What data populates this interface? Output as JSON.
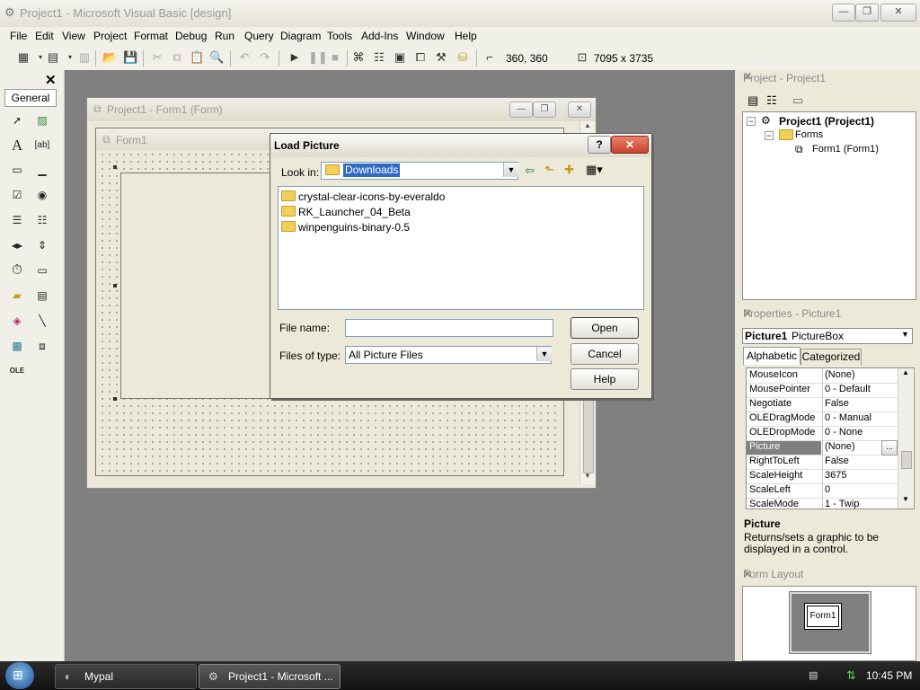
{
  "window": {
    "title": "Project1 - Microsoft Visual Basic [design]"
  },
  "menu": [
    "File",
    "Edit",
    "View",
    "Project",
    "Format",
    "Debug",
    "Run",
    "Query",
    "Diagram",
    "Tools",
    "Add-Ins",
    "Window",
    "Help"
  ],
  "toolbar": {
    "position": "360, 360",
    "size": "7095 x 3735"
  },
  "toolbox": {
    "tab_label": "General"
  },
  "form_window": {
    "title": "Project1 - Form1 (Form)",
    "form_caption": "Form1"
  },
  "dialog": {
    "title": "Load Picture",
    "look_in_label": "Look in:",
    "look_in_value": "Downloads",
    "files": [
      "crystal-clear-icons-by-everaldo",
      "RK_Launcher_04_Beta",
      "winpenguins-binary-0.5"
    ],
    "file_name_label": "File name:",
    "file_name_value": "",
    "files_of_type_label": "Files of type:",
    "files_of_type_value": "All Picture Files",
    "open_label": "Open",
    "cancel_label": "Cancel",
    "help_label": "Help",
    "help_icon": "?",
    "close_icon": "✕"
  },
  "project_panel": {
    "title": "Project - Project1",
    "root": "Project1 (Project1)",
    "folder": "Forms",
    "item": "Form1 (Form1)"
  },
  "properties_panel": {
    "title": "Properties - Picture1",
    "object_name": "Picture1",
    "object_type": "PictureBox",
    "tab_alpha": "Alphabetic",
    "tab_cat": "Categorized",
    "rows": [
      {
        "name": "MouseIcon",
        "value": "(None)"
      },
      {
        "name": "MousePointer",
        "value": "0 - Default"
      },
      {
        "name": "Negotiate",
        "value": "False"
      },
      {
        "name": "OLEDragMode",
        "value": "0 - Manual"
      },
      {
        "name": "OLEDropMode",
        "value": "0 - None"
      },
      {
        "name": "Picture",
        "value": "(None)"
      },
      {
        "name": "RightToLeft",
        "value": "False"
      },
      {
        "name": "ScaleHeight",
        "value": "3675"
      },
      {
        "name": "ScaleLeft",
        "value": "0"
      },
      {
        "name": "ScaleMode",
        "value": "1 - Twip"
      }
    ],
    "desc_title": "Picture",
    "desc_text": "Returns/sets a graphic to be displayed in a control."
  },
  "layout_panel": {
    "title": "Form Layout",
    "form_label": "Form1"
  },
  "taskbar": {
    "task1": "Mypal",
    "task2": "Project1 - Microsoft ...",
    "clock": "10:45 PM"
  },
  "colors": {
    "workspace": "#808080",
    "selected_row": "#808080",
    "dialog_close": "#c8442a"
  }
}
